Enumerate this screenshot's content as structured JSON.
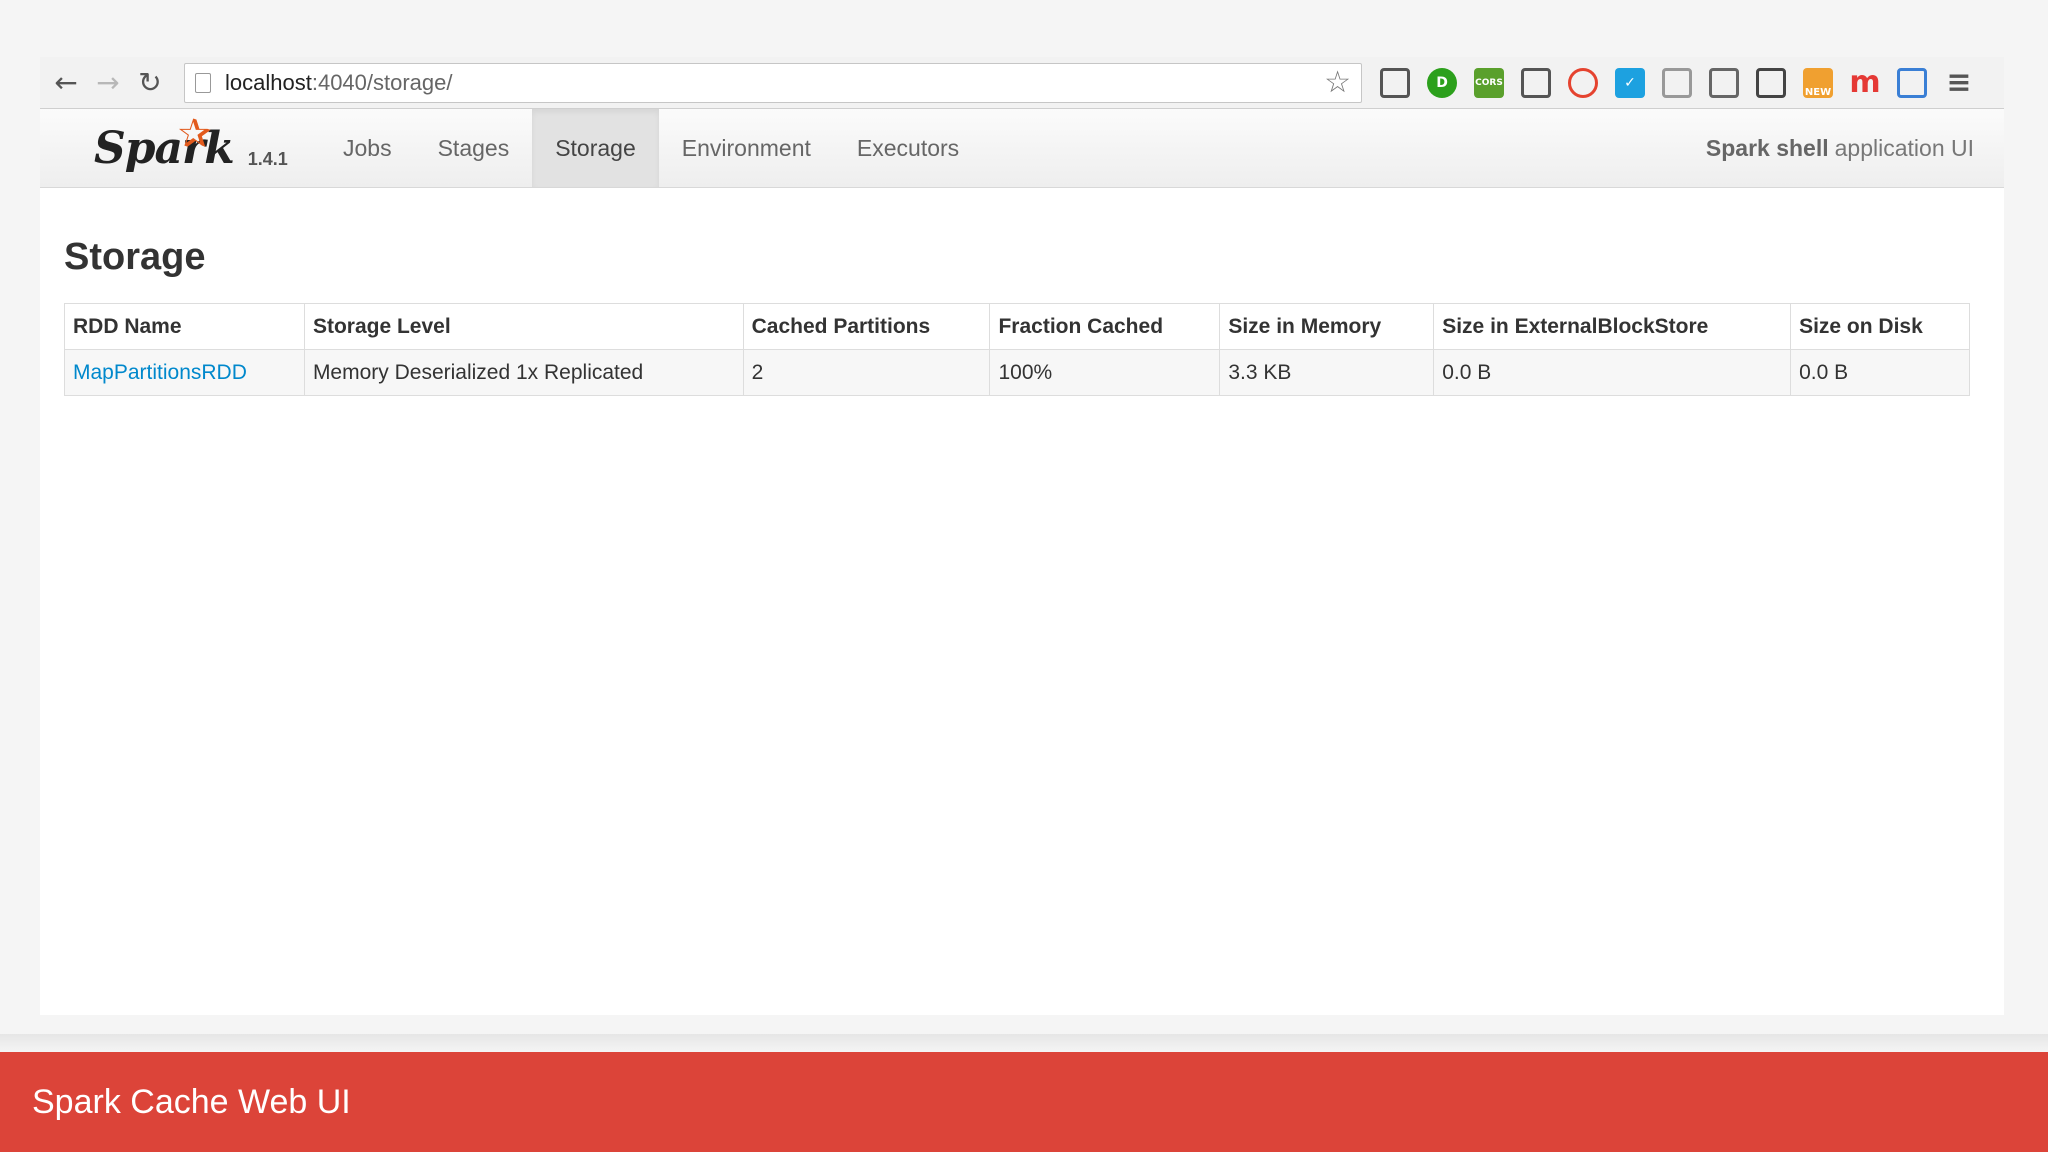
{
  "browser": {
    "url_host": "localhost",
    "url_rest": ":4040/storage/",
    "extensions": [
      {
        "name": "shield-icon",
        "glyph": "",
        "color": "#555555"
      },
      {
        "name": "instapaper-icon",
        "glyph": "D",
        "color": "#2ca01c"
      },
      {
        "name": "cors-icon",
        "glyph": "CORS",
        "color": "#5aa02c"
      },
      {
        "name": "pocket-icon",
        "glyph": "",
        "color": "#555555"
      },
      {
        "name": "stop-hand-icon",
        "glyph": "",
        "color": "#e5432f"
      },
      {
        "name": "check-icon",
        "glyph": "✓",
        "color": "#1da1e0"
      },
      {
        "name": "pickaxe-icon",
        "glyph": "",
        "color": "#999999"
      },
      {
        "name": "cast-icon",
        "glyph": "",
        "color": "#666666"
      },
      {
        "name": "film-icon",
        "glyph": "",
        "color": "#444444"
      },
      {
        "name": "new-badge-icon",
        "glyph": "NEW",
        "color": "#f0a030"
      },
      {
        "name": "m-icon",
        "glyph": "m",
        "color": "#e53935"
      },
      {
        "name": "bookmark-upload-icon",
        "glyph": "",
        "color": "#3a7fd5"
      },
      {
        "name": "menu-icon",
        "glyph": "≡",
        "color": "#555555"
      }
    ]
  },
  "spark": {
    "logo_text": "Spark",
    "version": "1.4.1",
    "tabs": [
      {
        "label": "Jobs",
        "name": "tab-jobs",
        "active": false
      },
      {
        "label": "Stages",
        "name": "tab-stages",
        "active": false
      },
      {
        "label": "Storage",
        "name": "tab-storage",
        "active": true
      },
      {
        "label": "Environment",
        "name": "tab-environment",
        "active": false
      },
      {
        "label": "Executors",
        "name": "tab-executors",
        "active": false
      }
    ],
    "app_title_bold": "Spark shell",
    "app_title_rest": "application UI"
  },
  "page": {
    "title": "Storage",
    "table": {
      "headers": [
        "RDD Name",
        "Storage Level",
        "Cached Partitions",
        "Fraction Cached",
        "Size in Memory",
        "Size in ExternalBlockStore",
        "Size on Disk"
      ],
      "rows": [
        [
          "MapPartitionsRDD",
          "Memory Deserialized 1x Replicated",
          "2",
          "100%",
          "3.3 KB",
          "0.0 B",
          "0.0 B"
        ]
      ]
    }
  },
  "banner": {
    "caption": "Spark Cache Web UI",
    "color": "#dc4439"
  }
}
